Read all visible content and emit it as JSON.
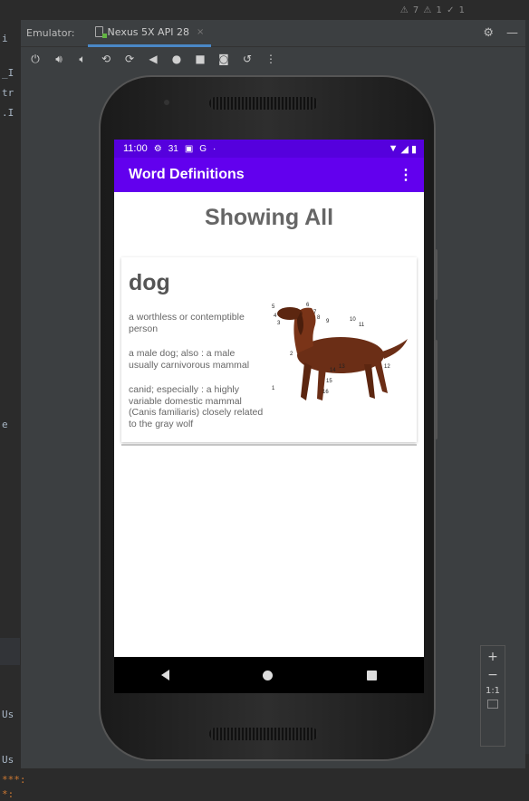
{
  "emulator": {
    "panel_label": "Emulator:",
    "device_tab": "Nexus 5X API 28",
    "tab_close": "×",
    "settings_icon": "gear-icon",
    "minimize_icon": "minimize-icon",
    "toolbar_icons": [
      "power-icon",
      "volume-up-icon",
      "volume-down-icon",
      "rotate-left-icon",
      "rotate-right-icon",
      "back-icon",
      "home-icon",
      "overview-icon",
      "screenshot-icon",
      "snapshot-icon",
      "more-icon"
    ]
  },
  "phone": {
    "statusbar": {
      "time": "11:00",
      "left_icons": [
        "⚙",
        "31",
        "▣",
        "G",
        "·"
      ],
      "right_icons": [
        "▼",
        "◢",
        "▮"
      ]
    },
    "appbar": {
      "title": "Word Definitions",
      "menu_icon": "⋮"
    },
    "heading": "Showing All",
    "card": {
      "word": "dog",
      "definitions": [
        "a worthless or contemptible person",
        "a male dog; also : a male usually carnivorous mammal",
        "canid; especially : a highly variable domestic mammal (Canis familiaris) closely related to the gray wolf"
      ],
      "image_labels": [
        "1",
        "2",
        "3",
        "4",
        "5",
        "6",
        "7",
        "8",
        "9",
        "10",
        "11",
        "12",
        "13",
        "14",
        "15",
        "16"
      ]
    },
    "navbar": [
      "back",
      "home",
      "overview"
    ]
  },
  "zoom": {
    "plus": "+",
    "minus": "−",
    "one_to_one": "1:1"
  },
  "colors": {
    "statusbar": "#5500dd",
    "appbar": "#6200ee",
    "ide_bg": "#2b2b2b",
    "panel_bg": "#3c3f41"
  }
}
